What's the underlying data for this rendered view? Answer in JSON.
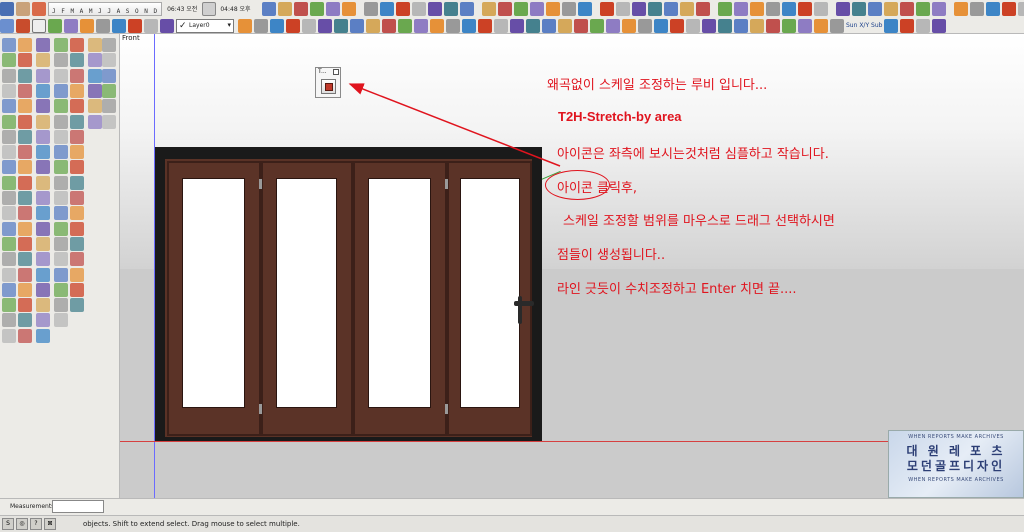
{
  "toolbar": {
    "months": "J F M A M J J A S O N D",
    "time_1": "06:43 오전",
    "time_2": "04:48 오후",
    "layer_name": "Layer0",
    "sun_text": "Sun X/Y Sub"
  },
  "viewport": {
    "view_label": "Front"
  },
  "tool_window": {
    "title": "T..."
  },
  "annotations": {
    "line1": "왜곡없이 스케일 조정하는 루비 입니다...",
    "line2": "T2H-Stretch-by area",
    "line3": "아이콘은 좌측에 보시는것처럼 심플하고 작습니다.",
    "line4": "아이콘 클릭후,",
    "line5": "스케일 조정할 범위를 마우스로 드래그 선택하시면",
    "line6": "점들이 생성됩니다..",
    "line7": "라인 긋듯이 수치조정하고 Enter 치면 끝...."
  },
  "watermark": {
    "top_text": "WHEN REPORTS MAKE ARCHIVES",
    "line_1": "대 원 레 포 츠",
    "line_2": "모던골프디자인",
    "bottom_text": "WHEN REPORTS MAKE ARCHIVES"
  },
  "measurements": {
    "label": "Measurements",
    "value": ""
  },
  "status": {
    "icon_labels": [
      "S",
      "◎",
      "?",
      "⊠"
    ],
    "text": "objects. Shift to extend select. Drag mouse to select multiple."
  },
  "colors": {
    "annotation_red": "#e0141e",
    "door_wood": "#5b3327",
    "door_frame": "#1a1a1a"
  }
}
